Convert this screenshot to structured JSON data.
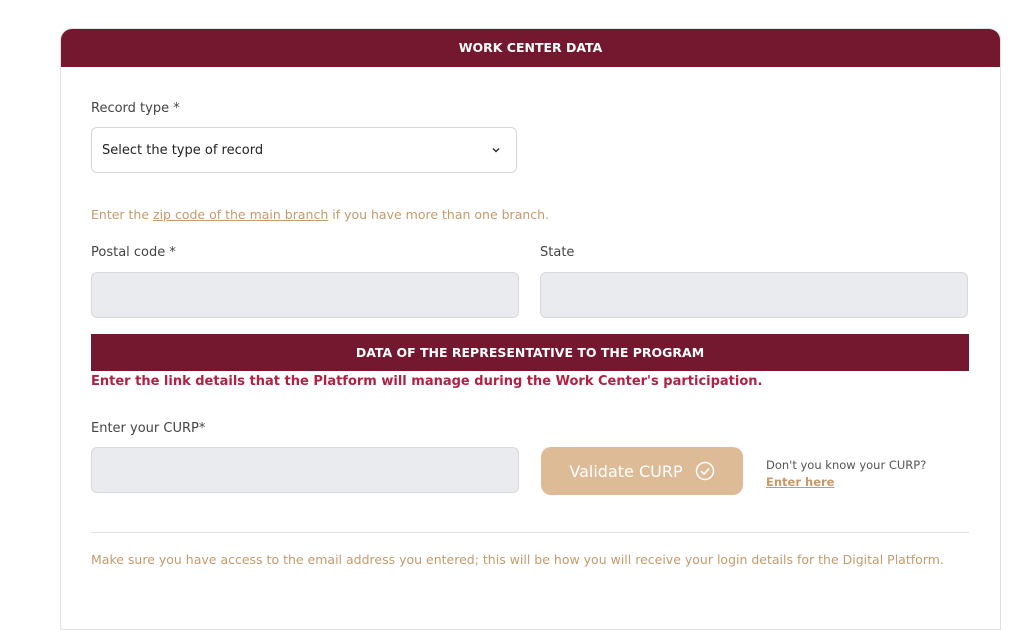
{
  "header": {
    "title": "WORK CENTER DATA"
  },
  "record_type": {
    "label": "Record type *",
    "selected": "Select the type of record"
  },
  "hint": {
    "prefix": "Enter the ",
    "link": "zip code of the main branch",
    "suffix": " if you have more than one branch."
  },
  "postal_code": {
    "label": "Postal code *",
    "value": ""
  },
  "state": {
    "label": "State",
    "value": ""
  },
  "representative": {
    "title": "DATA OF THE REPRESENTATIVE TO THE PROGRAM",
    "description": "Enter the link details that the Platform will manage during the Work Center's participation."
  },
  "curp": {
    "label": "Enter your CURP*",
    "value": "",
    "validate_button": "Validate CURP",
    "help_text": "Don't you know your CURP?",
    "help_link": "Enter here"
  },
  "note": "Make sure you have access to the email address you entered; this will be how you will receive your login details for the Digital Platform.",
  "colors": {
    "brand": "#741830",
    "accent": "#c49a6c",
    "emphasis": "#b22043",
    "button": "#ddbb97"
  },
  "icons": {
    "select": "chevron-down-icon",
    "validate": "check-circle-icon"
  }
}
